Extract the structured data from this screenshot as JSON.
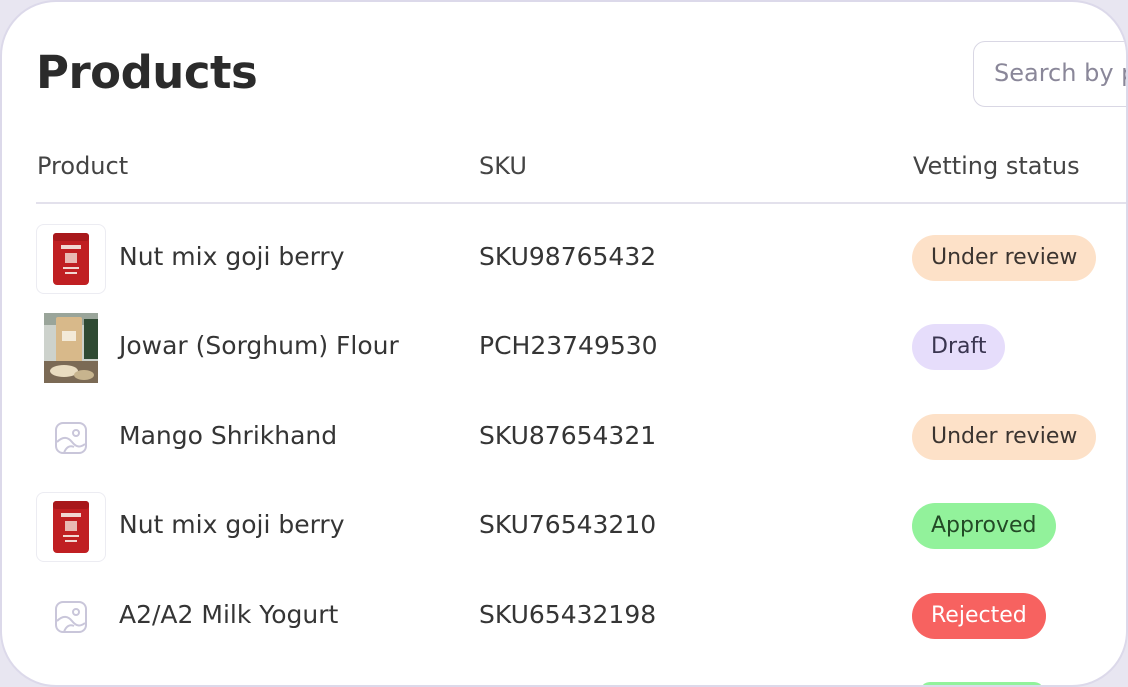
{
  "page": {
    "title": "Products"
  },
  "search": {
    "placeholder": "Search by product"
  },
  "columns": {
    "product": "Product",
    "sku": "SKU",
    "vetting_status": "Vetting status"
  },
  "rows": [
    {
      "product": "Nut mix goji berry",
      "sku": "SKU98765432",
      "status": "Under review",
      "status_kind": "review",
      "thumbnail": "red-pouch-image"
    },
    {
      "product": "Jowar (Sorghum) Flour",
      "sku": "PCH23749530",
      "status": "Draft",
      "status_kind": "draft",
      "thumbnail": "kraft-bag-photo"
    },
    {
      "product": "Mango Shrikhand",
      "sku": "SKU87654321",
      "status": "Under review",
      "status_kind": "review",
      "thumbnail": "image-placeholder-icon"
    },
    {
      "product": "Nut mix goji berry",
      "sku": "SKU76543210",
      "status": "Approved",
      "status_kind": "approved",
      "thumbnail": "red-pouch-image"
    },
    {
      "product": "A2/A2 Milk Yogurt",
      "sku": "SKU65432198",
      "status": "Rejected",
      "status_kind": "rejected",
      "thumbnail": "image-placeholder-icon"
    }
  ],
  "colors": {
    "under_review": "#fde1c8",
    "draft": "#e6ddfb",
    "approved": "#92f29b",
    "rejected": "#f76260"
  }
}
